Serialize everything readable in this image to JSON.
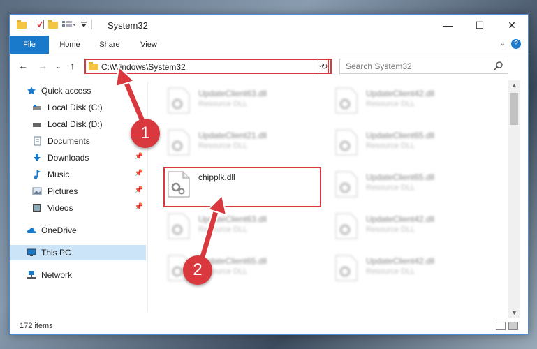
{
  "window": {
    "title": "System32"
  },
  "controls": {
    "minimize": "—",
    "maximize": "☐",
    "close": "✕"
  },
  "ribbon": {
    "tabs": [
      "File",
      "Home",
      "Share",
      "View"
    ],
    "help": "?"
  },
  "address": {
    "path": "C:\\Windows\\System32"
  },
  "search": {
    "placeholder": "Search System32"
  },
  "sidebar": {
    "items": [
      {
        "label": "Quick access",
        "icon": "star-icon",
        "pinned": false
      },
      {
        "label": "Local Disk (C:)",
        "icon": "drive-icon",
        "pinned": false
      },
      {
        "label": "Local Disk (D:)",
        "icon": "drive-icon",
        "pinned": false
      },
      {
        "label": "Documents",
        "icon": "documents-icon",
        "pinned": true
      },
      {
        "label": "Downloads",
        "icon": "downloads-icon",
        "pinned": true
      },
      {
        "label": "Music",
        "icon": "music-icon",
        "pinned": true
      },
      {
        "label": "Pictures",
        "icon": "pictures-icon",
        "pinned": true
      },
      {
        "label": "Videos",
        "icon": "videos-icon",
        "pinned": true
      },
      {
        "label": "OneDrive",
        "icon": "cloud-icon",
        "pinned": false
      },
      {
        "label": "This PC",
        "icon": "computer-icon",
        "pinned": false,
        "selected": true
      },
      {
        "label": "Network",
        "icon": "network-icon",
        "pinned": false
      }
    ]
  },
  "files": [
    {
      "name": "UpdateClient63.dll",
      "type": "Resource DLL",
      "blurred": true
    },
    {
      "name": "UpdateClient42.dll",
      "type": "Resource DLL",
      "blurred": true
    },
    {
      "name": "UpdateClient21.dll",
      "type": "Resource DLL",
      "blurred": true
    },
    {
      "name": "UpdateClient65.dll",
      "type": "Resource DLL",
      "blurred": true
    },
    {
      "name": "chipplk.dll",
      "type": "",
      "blurred": false
    },
    {
      "name": "UpdateClient65.dll",
      "type": "Resource DLL",
      "blurred": true
    },
    {
      "name": "UpdateClient63.dll",
      "type": "Resource DLL",
      "blurred": true
    },
    {
      "name": "UpdateClient42.dll",
      "type": "Resource DLL",
      "blurred": true
    },
    {
      "name": "UpdateClient65.dll",
      "type": "Resource DLL",
      "blurred": true
    },
    {
      "name": "UpdateClient42.dll",
      "type": "Resource DLL",
      "blurred": true
    }
  ],
  "status": {
    "count": "172 items"
  },
  "callouts": {
    "one": "1",
    "two": "2"
  },
  "colors": {
    "accent": "#1979ca",
    "highlight": "#d9393e",
    "selected": "#cce4f7"
  }
}
